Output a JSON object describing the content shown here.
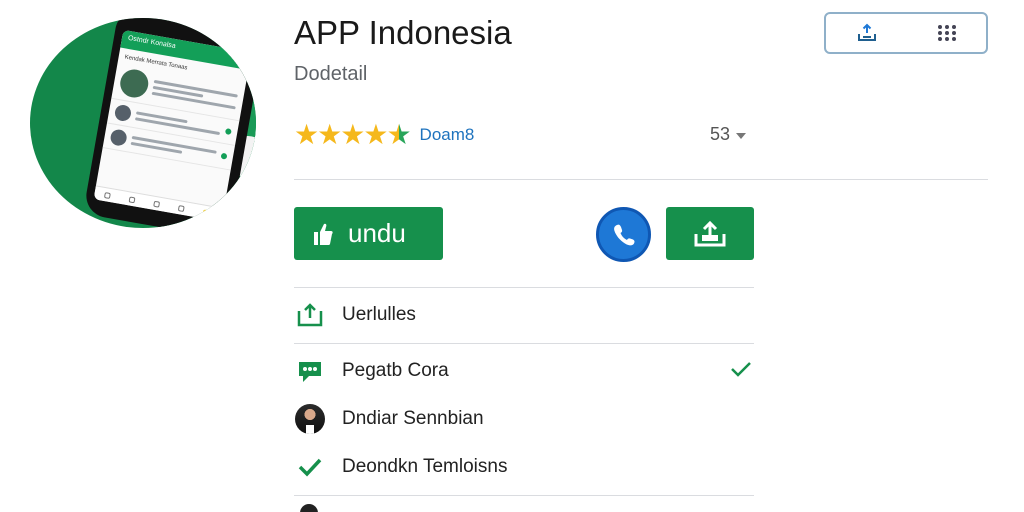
{
  "app": {
    "title": "APP Indonesia",
    "subtitle": "Dodetail"
  },
  "hero": {
    "phone_bar_text": "Ostndr Konalsa",
    "phone_header_text": "Kendak Merrata Tonaas"
  },
  "top_actions": {
    "icons": [
      "share-tray-icon",
      "grid-menu-icon"
    ]
  },
  "rating": {
    "stars": 4.5,
    "label": "Doam8",
    "count": "53"
  },
  "buttons": {
    "download_label": "undu",
    "call_icon": "phone-icon",
    "share_icon": "share-upload-icon"
  },
  "list": {
    "items": [
      {
        "label": "Uerlulles",
        "icon": "share-box-icon"
      },
      {
        "label": "Pegatb Cora",
        "icon": "chat-icon"
      },
      {
        "label": "Dndiar Sennbian",
        "icon": "avatar"
      },
      {
        "label": "Deondkn Temloisns",
        "icon": "check-icon"
      }
    ]
  },
  "colors": {
    "brand_green": "#16904c",
    "call_blue": "#1e78d6",
    "star_gold": "#f5b81c",
    "link_blue": "#1e73be"
  }
}
